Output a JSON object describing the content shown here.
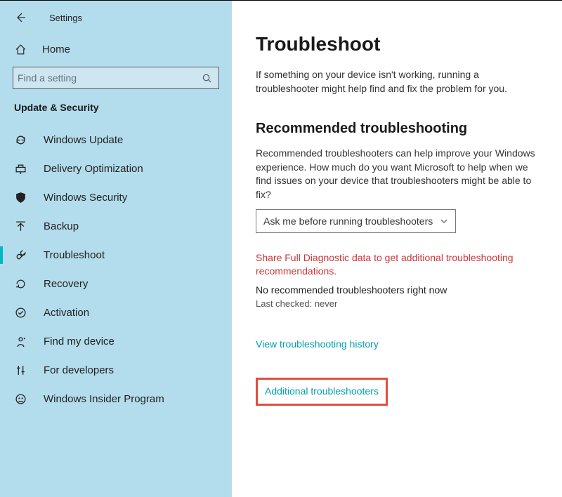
{
  "header": {
    "title": "Settings"
  },
  "sidebar": {
    "home_label": "Home",
    "search_placeholder": "Find a setting",
    "category": "Update & Security",
    "items": [
      {
        "label": "Windows Update",
        "icon": "sync-icon"
      },
      {
        "label": "Delivery Optimization",
        "icon": "delivery-icon"
      },
      {
        "label": "Windows Security",
        "icon": "shield-icon"
      },
      {
        "label": "Backup",
        "icon": "backup-icon"
      },
      {
        "label": "Troubleshoot",
        "icon": "troubleshoot-icon"
      },
      {
        "label": "Recovery",
        "icon": "recovery-icon"
      },
      {
        "label": "Activation",
        "icon": "activation-icon"
      },
      {
        "label": "Find my device",
        "icon": "findmydevice-icon"
      },
      {
        "label": "For developers",
        "icon": "developers-icon"
      },
      {
        "label": "Windows Insider Program",
        "icon": "insider-icon"
      }
    ],
    "active_index": 4
  },
  "main": {
    "title": "Troubleshoot",
    "intro": "If something on your device isn't working, running a troubleshooter might help find and fix the problem for you.",
    "section_heading": "Recommended troubleshooting",
    "section_desc": "Recommended troubleshooters can help improve your Windows experience. How much do you want Microsoft to help when we find issues on your device that troubleshooters might be able to fix?",
    "dropdown_selected": "Ask me before running troubleshooters",
    "warning": "Share Full Diagnostic data to get additional troubleshooting recommendations.",
    "no_recommended": "No recommended troubleshooters right now",
    "last_checked": "Last checked: never",
    "link_history": "View troubleshooting history",
    "link_additional": "Additional troubleshooters"
  }
}
